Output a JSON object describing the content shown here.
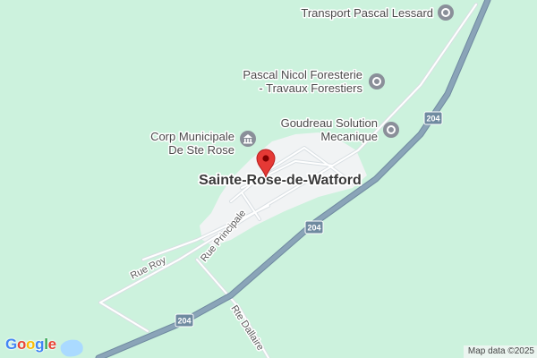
{
  "map": {
    "place_label": "Sainte-Rose-de-Watford",
    "pois": [
      {
        "id": "transport",
        "label_lines": [
          "Transport Pascal Lessard"
        ],
        "icon": "business-pin-icon"
      },
      {
        "id": "foresterie",
        "label_lines": [
          "Pascal Nicol Foresterie",
          "- Travaux Forestiers"
        ],
        "icon": "business-pin-icon"
      },
      {
        "id": "goudreau",
        "label_lines": [
          "Goudreau Solution",
          "Mecanique"
        ],
        "icon": "business-pin-icon"
      },
      {
        "id": "municipale",
        "label_lines": [
          "Corp Municipale",
          "De Ste Rose"
        ],
        "icon": "city-hall-pin-icon"
      }
    ],
    "streets": {
      "rue_roy": "Rue Roy",
      "rue_principale": "Rue Principale",
      "rte_dallaire": "Rte Dallaire"
    },
    "route_shields": [
      "204",
      "204",
      "204"
    ],
    "marker": {
      "icon": "red-location-marker-icon"
    },
    "logo": {
      "letters": [
        "G",
        "o",
        "o",
        "g",
        "l",
        "e"
      ],
      "colors": [
        "#4285F4",
        "#EA4335",
        "#FBBC05",
        "#4285F4",
        "#34A853",
        "#EA4335"
      ]
    },
    "attribution": "Map data ©2025",
    "colors": {
      "land": "#ccf2dd",
      "highway": "#8aa4b8",
      "settlement": "#f1f3f4",
      "marker": "#e53935",
      "water": "#aadaff"
    }
  }
}
